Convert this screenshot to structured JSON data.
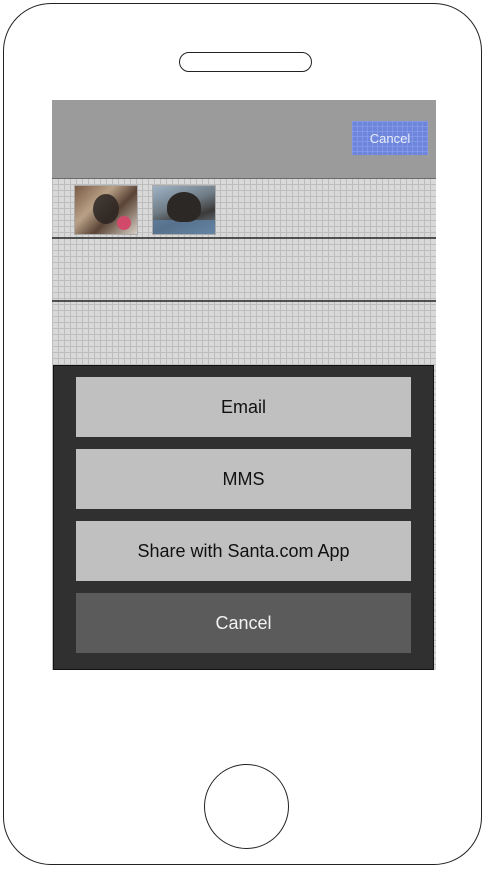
{
  "top_bar": {
    "cancel_label": "Cancel"
  },
  "photos": [
    {
      "icon": "photo-thumbnail"
    },
    {
      "icon": "photo-thumbnail"
    }
  ],
  "share_sheet": {
    "options": [
      {
        "label": "Email"
      },
      {
        "label": "MMS"
      },
      {
        "label": "Share with Santa.com App"
      }
    ],
    "cancel_label": "Cancel"
  },
  "colors": {
    "accent_button": "#6d86dc",
    "sheet_background": "#303030",
    "option_button": "#c0c0c0",
    "cancel_button": "#5b5b5b"
  }
}
